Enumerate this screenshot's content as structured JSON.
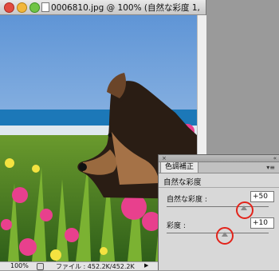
{
  "document_window": {
    "title": "0006810.jpg @ 100% (自然な彩度 1, レイ",
    "status": {
      "zoom": "100%",
      "file_info": "ファイル : 452.2K/452.2K"
    }
  },
  "adjustments_panel": {
    "tab_label": "色調補正",
    "subtitle": "自然な彩度",
    "sliders": [
      {
        "label": "自然な彩度 :",
        "value": "+50",
        "level_fraction": 0.6
      },
      {
        "label": "彩度 :",
        "value": "+10",
        "level_fraction": 0.52
      }
    ]
  },
  "colors": {
    "highlight": "#e2231a",
    "panel_bg": "#d8d8d8"
  },
  "icons": [
    "close-icon",
    "minimize-icon",
    "zoom-icon",
    "document-icon",
    "panel-menu-icon",
    "slider-thumb-icon"
  ]
}
